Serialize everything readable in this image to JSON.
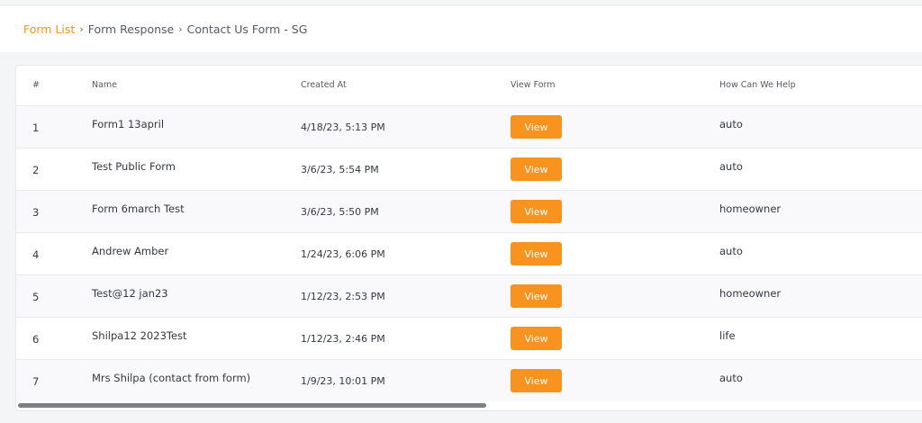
{
  "breadcrumb": {
    "items": [
      "Form List",
      "Form Response",
      "Contact Us Form - SG"
    ],
    "separator": "›"
  },
  "table": {
    "headers": {
      "num": "#",
      "name": "Name",
      "created_at": "Created At",
      "view_form": "View Form",
      "how_can_we_help": "How Can We Help"
    },
    "rows": [
      {
        "num": "1",
        "name": "Form1 13april",
        "created_at": "4/18/23, 5:13 PM",
        "view": "View",
        "help": "auto"
      },
      {
        "num": "2",
        "name": "Test Public Form",
        "created_at": "3/6/23, 5:54 PM",
        "view": "View",
        "help": "auto"
      },
      {
        "num": "3",
        "name": "Form 6march Test",
        "created_at": "3/6/23, 5:50 PM",
        "view": "View",
        "help": "homeowner"
      },
      {
        "num": "4",
        "name": "Andrew Amber",
        "created_at": "1/24/23, 6:06 PM",
        "view": "View",
        "help": "auto"
      },
      {
        "num": "5",
        "name": "Test@12 jan23",
        "created_at": "1/12/23, 2:53 PM",
        "view": "View",
        "help": "homeowner"
      },
      {
        "num": "6",
        "name": "Shilpa12 2023Test",
        "created_at": "1/12/23, 2:46 PM",
        "view": "View",
        "help": "life"
      },
      {
        "num": "7",
        "name": "Mrs Shilpa (contact from form)",
        "created_at": "1/9/23, 10:01 PM",
        "view": "View",
        "help": "auto"
      }
    ]
  },
  "colors": {
    "accent": "#f7931e",
    "row_shade": "#f9f9fb",
    "background": "#f4f5f7",
    "scrollbar": "#7d7f82"
  }
}
